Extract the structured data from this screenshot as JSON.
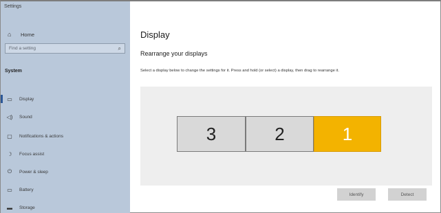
{
  "window": {
    "title": "Settings"
  },
  "sidebar": {
    "home_label": "Home",
    "search_placeholder": "Find a setting",
    "section_label": "System",
    "items": [
      {
        "label": "Display",
        "icon": "monitor-icon",
        "active": true
      },
      {
        "label": "Sound",
        "icon": "speaker-icon"
      },
      {
        "label": "Notifications & actions",
        "icon": "notifications-icon"
      },
      {
        "label": "Focus assist",
        "icon": "moon-icon"
      },
      {
        "label": "Power & sleep",
        "icon": "power-icon"
      },
      {
        "label": "Battery",
        "icon": "battery-icon"
      },
      {
        "label": "Storage",
        "icon": "storage-icon"
      }
    ]
  },
  "main": {
    "title": "Display",
    "subtitle": "Rearrange your displays",
    "description": "Select a display below to change the settings for it. Press and hold (or select) a display, then drag to rearrange it.",
    "displays": [
      {
        "number": "3",
        "selected": false
      },
      {
        "number": "2",
        "selected": false
      },
      {
        "number": "1",
        "selected": true
      }
    ],
    "identify_label": "Identify",
    "detect_label": "Detect"
  },
  "colors": {
    "sidebar_bg": "#b9c8da",
    "selected_display": "#f3b300",
    "display_bg": "#d9d9d9",
    "arrange_bg": "#eeeeee"
  }
}
